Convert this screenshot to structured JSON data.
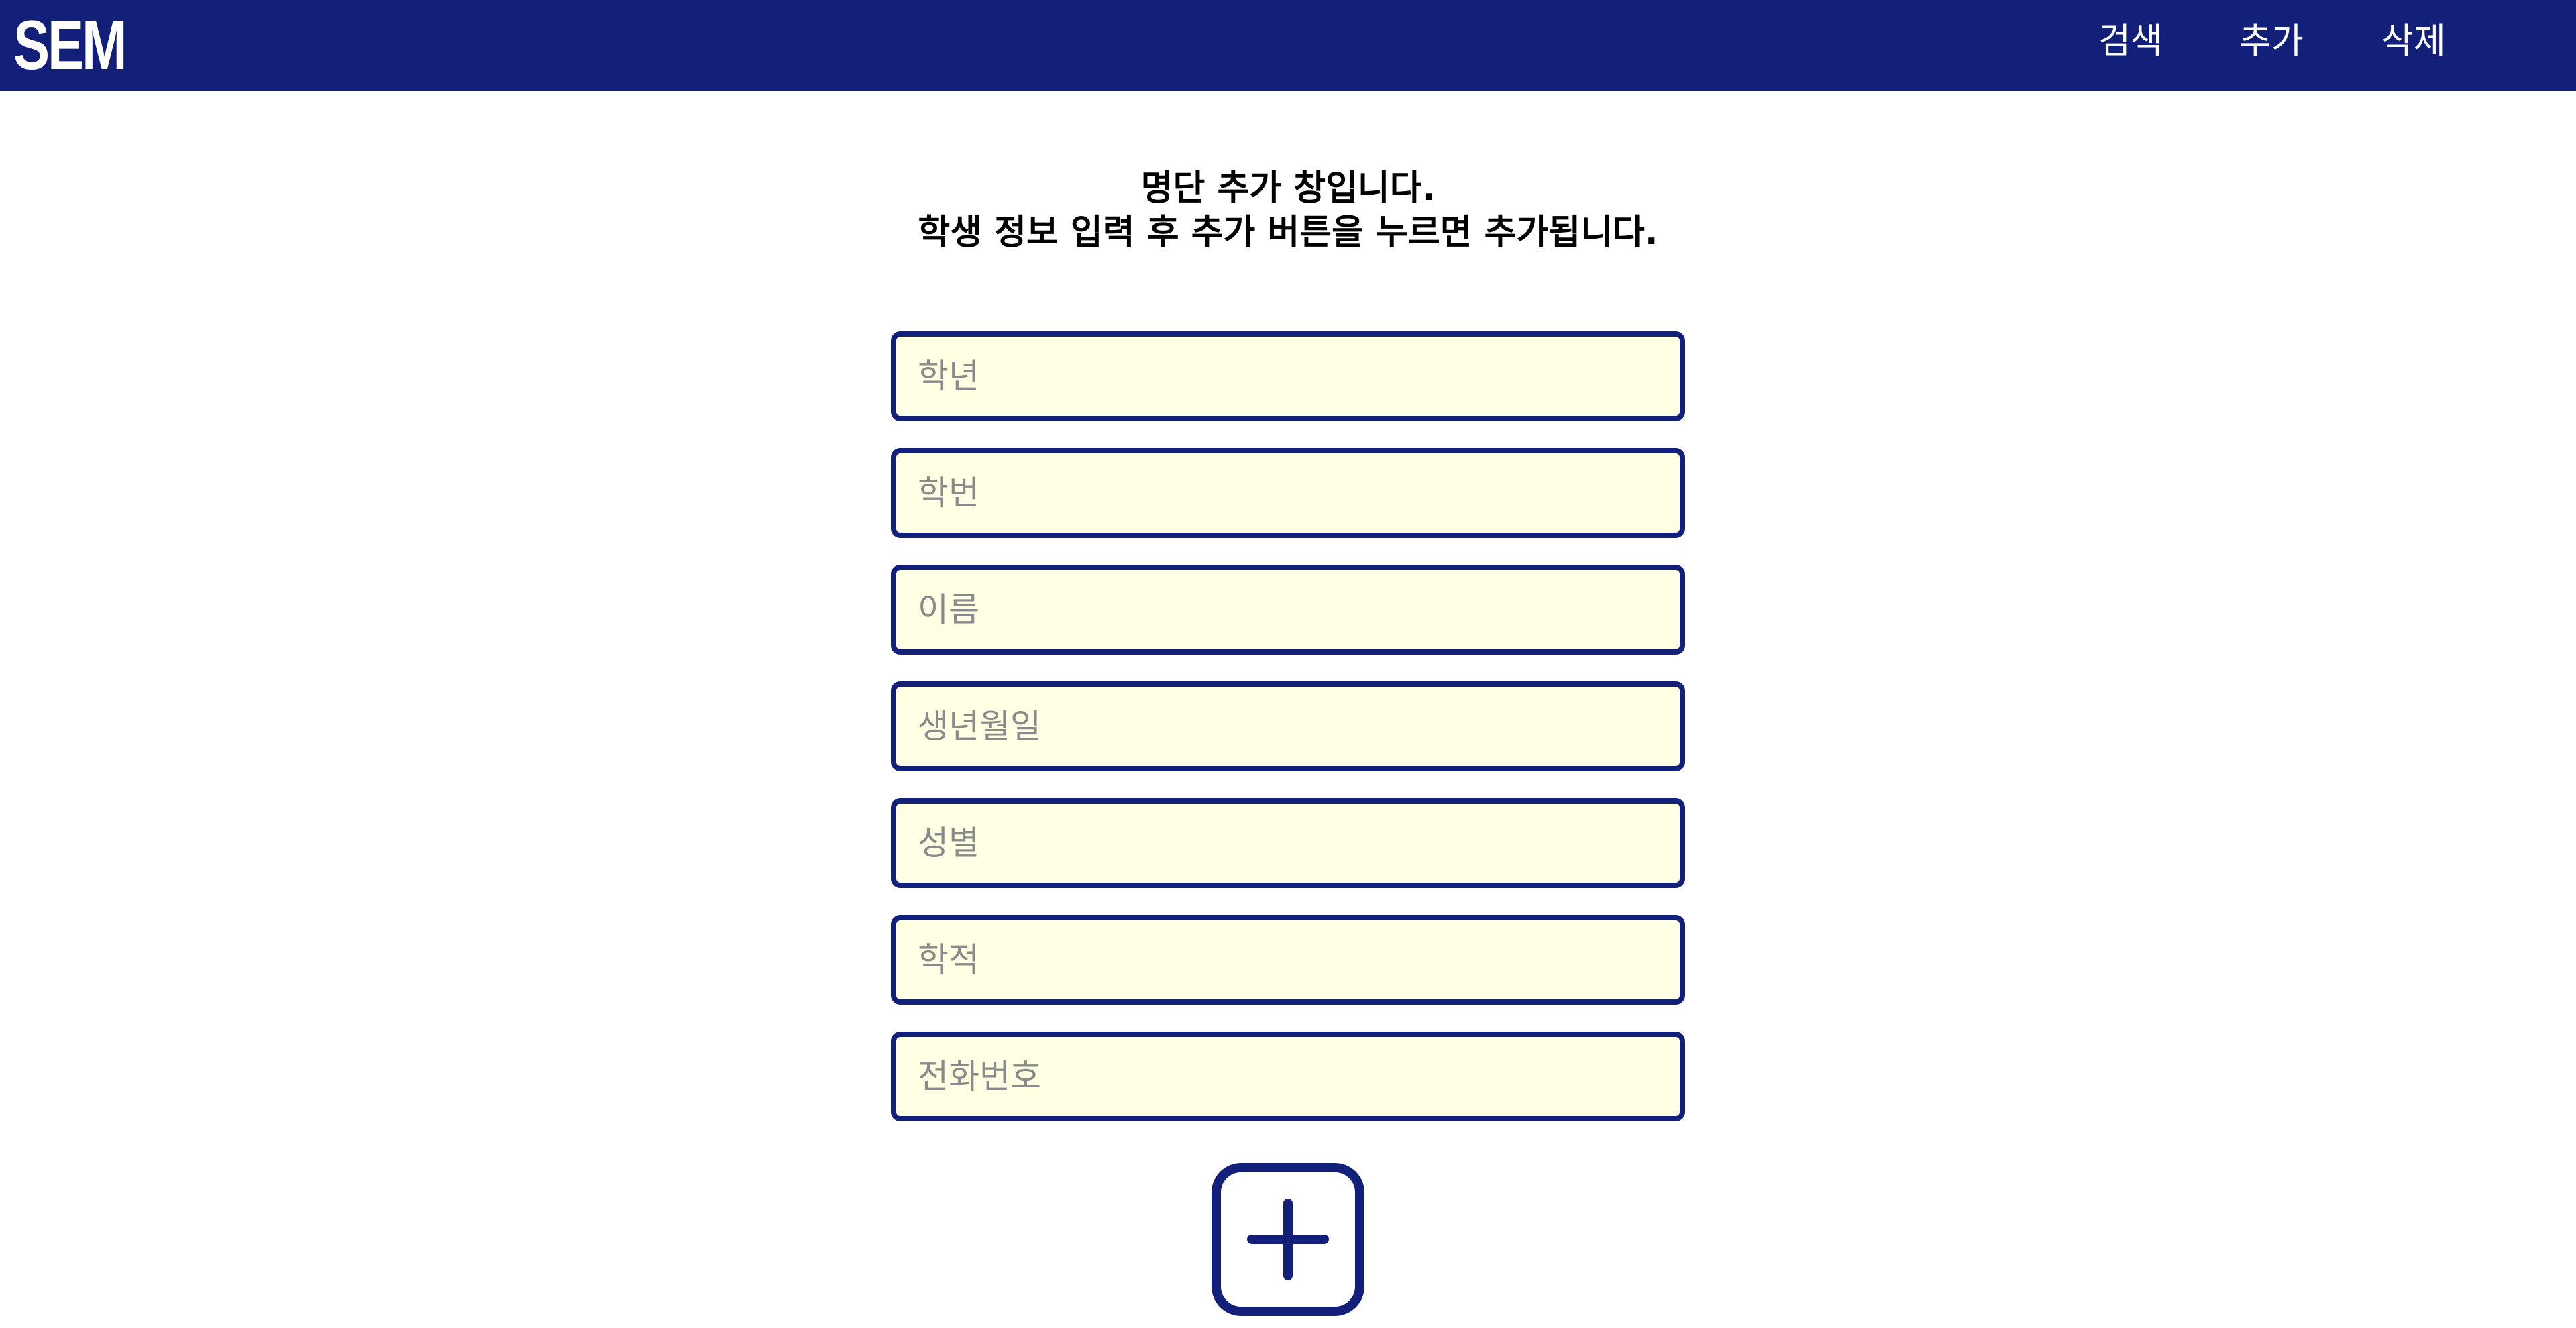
{
  "app": {
    "logo_text": "SEM"
  },
  "nav": {
    "search_label": "검색",
    "add_label": "추가",
    "delete_label": "삭제"
  },
  "instructions": {
    "line1": "명단 추가 창입니다.",
    "line2": "학생 정보 입력 후 추가 버튼을 누르면 추가됩니다."
  },
  "form": {
    "fields": [
      {
        "placeholder": "학년",
        "value": ""
      },
      {
        "placeholder": "학번",
        "value": ""
      },
      {
        "placeholder": "이름",
        "value": ""
      },
      {
        "placeholder": "생년월일",
        "value": ""
      },
      {
        "placeholder": "성별",
        "value": ""
      },
      {
        "placeholder": "학적",
        "value": ""
      },
      {
        "placeholder": "전화번호",
        "value": ""
      }
    ],
    "submit_icon": "plus-square-icon"
  },
  "colors": {
    "primary": "#13207a",
    "field_background": "#ffffe3",
    "placeholder": "#8a8a8a",
    "background": "#ffffff"
  }
}
